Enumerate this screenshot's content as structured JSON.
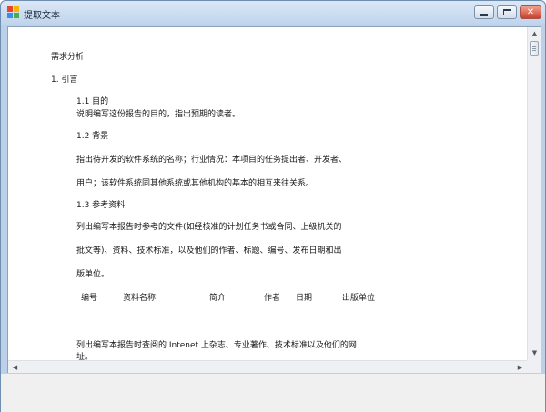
{
  "window": {
    "title": "提取文本",
    "controls": {
      "minimize_icon": "minimize-icon",
      "maximize_icon": "maximize-icon",
      "close_icon": "close-icon",
      "close_glyph": "✕"
    }
  },
  "document": {
    "lines": [
      "需求分析",
      "1. 引言",
      "1.1 目的",
      "说明编写这份报告的目的，指出预期的读者。",
      "1.2 背景",
      "指出待开发的软件系统的名称；行业情况：本项目的任务提出者、开发者、",
      "用户；该软件系统同其他系统或其他机构的基本的相互来往关系。",
      "1.3 参考资料",
      "列出编写本报告时参考的文件(如经核准的计划任务书或合同、上级机关的",
      "批文等)、资料、技术标准，以及他们的作者、标题、编号、发布日期和出",
      "版单位。",
      "列出编写本报告时查阅的 Intenet 上杂志、专业著作、技术标准以及他们的网",
      "址。"
    ],
    "table_header": [
      "编号",
      "资料名称",
      "简介",
      "作者",
      "日期",
      "出版单位"
    ]
  },
  "scrollbars": {
    "up_arrow": "▲",
    "down_arrow": "▼",
    "left_arrow": "◀",
    "right_arrow": "▶"
  }
}
